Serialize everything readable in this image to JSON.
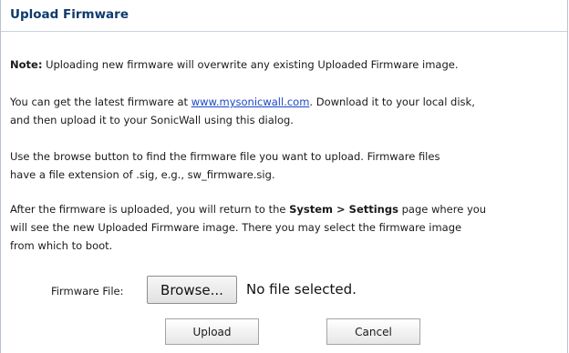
{
  "dialog": {
    "title": "Upload Firmware"
  },
  "note": {
    "label": "Note:",
    "text": " Uploading new firmware will overwrite any existing Uploaded Firmware image."
  },
  "para_get": {
    "line1_before": "You can get the latest firmware at ",
    "link_text": "www.mysonicwall.com",
    "line1_after": ". Download it to your local disk,",
    "line2": "and then upload it to your SonicWall using this dialog."
  },
  "para_browse": {
    "line1": "Use the browse button to find the firmware file you want to upload. Firmware files",
    "line2": "have a file extension of .sig, e.g., sw_firmware.sig."
  },
  "para_after": {
    "line1_before": "After the firmware is uploaded, you will return to the ",
    "bold": "System > Settings",
    "line1_after": " page where you",
    "line2": "will see the new Uploaded Firmware image. There you may select the firmware image",
    "line3": "from which to boot."
  },
  "file_field": {
    "label": "Firmware File:",
    "browse_label": "Browse...",
    "status": "No file selected."
  },
  "actions": {
    "upload_label": "Upload",
    "cancel_label": "Cancel"
  }
}
